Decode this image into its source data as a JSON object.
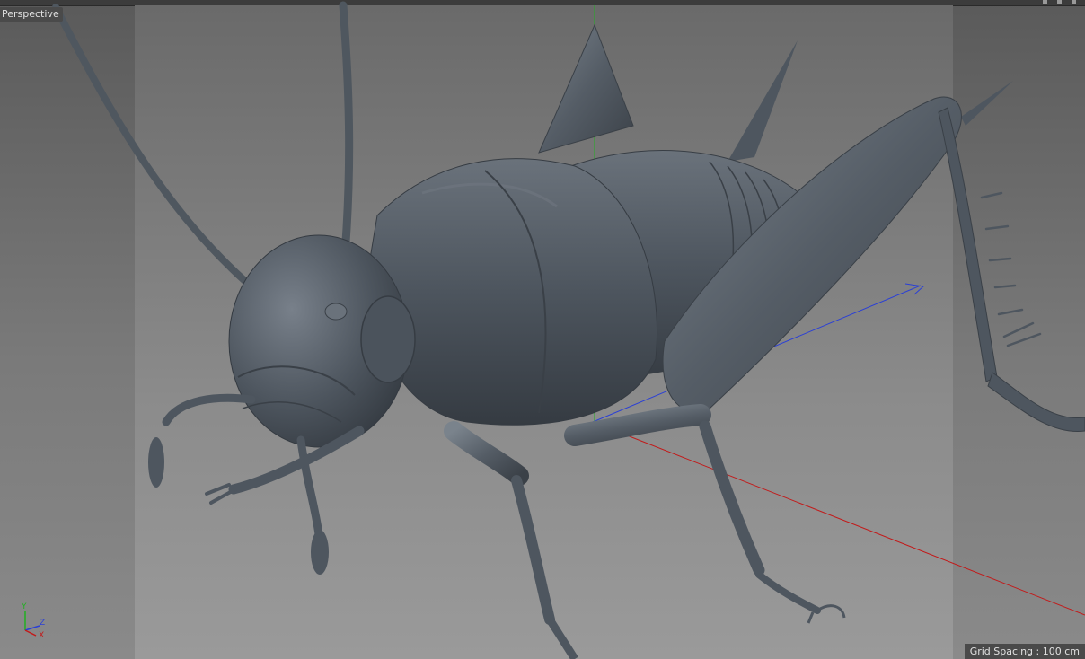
{
  "viewport": {
    "view_name": "Perspective",
    "grid_spacing": "Grid Spacing : 100 cm"
  },
  "axis_gizmo": {
    "y_label": "Y",
    "z_label": "Z",
    "x_label": "X"
  },
  "colors": {
    "model": "#4e565f",
    "x_axis": "#c21a1a",
    "y_axis": "#21b021",
    "z_axis": "#2a3fd6"
  },
  "icons": [
    "window-control-icon"
  ]
}
